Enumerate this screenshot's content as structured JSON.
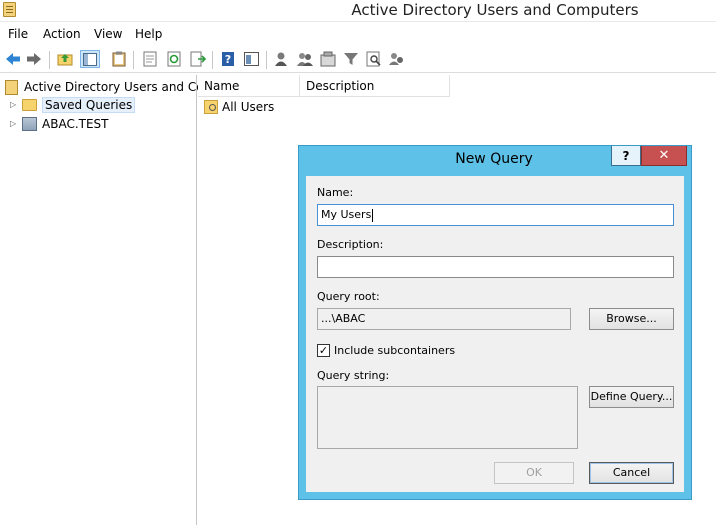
{
  "window": {
    "title": "Active Directory Users and Computers"
  },
  "menu": [
    "File",
    "Action",
    "View",
    "Help"
  ],
  "toolbar": {
    "icons": [
      "back-arrow-icon",
      "forward-arrow-icon",
      "up-folder-icon",
      "show-hide-tree-icon",
      "clipboard-icon",
      "export-list-icon",
      "refresh-icon",
      "export-icon",
      "help-icon",
      "console-icon",
      "new-user-icon",
      "new-group-icon",
      "new-ou-icon",
      "filter-icon",
      "find-icon",
      "add-to-group-icon"
    ]
  },
  "tree": {
    "root_label": "Active Directory Users and Com",
    "items": [
      {
        "label": "Saved Queries"
      },
      {
        "label": "ABAC.TEST"
      }
    ]
  },
  "list": {
    "columns": [
      "Name",
      "Description"
    ],
    "rows": [
      {
        "name": "All Users"
      }
    ]
  },
  "dialog": {
    "title": "New Query",
    "help_label": "?",
    "close_label": "✕",
    "name_label": "Name:",
    "name_value": "My Users",
    "description_label": "Description:",
    "description_value": "",
    "query_root_label": "Query root:",
    "query_root_value": "...\\ABAC",
    "browse_label": "Browse...",
    "include_subcontainers_label": "Include subcontainers",
    "include_subcontainers_checked": true,
    "query_string_label": "Query string:",
    "query_string_value": "",
    "define_query_label": "Define Query...",
    "ok_label": "OK",
    "cancel_label": "Cancel"
  },
  "colors": {
    "dialog_frame": "#5ec1e8",
    "close_button": "#c75050",
    "selection": "#e5f0fb"
  }
}
